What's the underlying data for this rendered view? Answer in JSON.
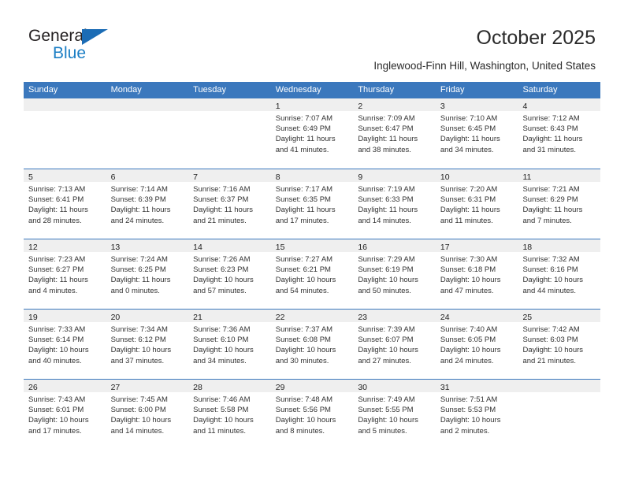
{
  "brand": {
    "name_top": "General",
    "name_bottom": "Blue"
  },
  "header": {
    "title": "October 2025",
    "subtitle": "Inglewood-Finn Hill, Washington, United States"
  },
  "colors": {
    "header_blue": "#3b78bd",
    "brand_blue": "#1b7ec4",
    "day_band_gray": "#efefef"
  },
  "weekdays": [
    "Sunday",
    "Monday",
    "Tuesday",
    "Wednesday",
    "Thursday",
    "Friday",
    "Saturday"
  ],
  "weeks": [
    [
      {
        "day": "",
        "empty": true
      },
      {
        "day": "",
        "empty": true
      },
      {
        "day": "",
        "empty": true
      },
      {
        "day": "1",
        "sunrise": "Sunrise: 7:07 AM",
        "sunset": "Sunset: 6:49 PM",
        "daylight1": "Daylight: 11 hours",
        "daylight2": "and 41 minutes."
      },
      {
        "day": "2",
        "sunrise": "Sunrise: 7:09 AM",
        "sunset": "Sunset: 6:47 PM",
        "daylight1": "Daylight: 11 hours",
        "daylight2": "and 38 minutes."
      },
      {
        "day": "3",
        "sunrise": "Sunrise: 7:10 AM",
        "sunset": "Sunset: 6:45 PM",
        "daylight1": "Daylight: 11 hours",
        "daylight2": "and 34 minutes."
      },
      {
        "day": "4",
        "sunrise": "Sunrise: 7:12 AM",
        "sunset": "Sunset: 6:43 PM",
        "daylight1": "Daylight: 11 hours",
        "daylight2": "and 31 minutes."
      }
    ],
    [
      {
        "day": "5",
        "sunrise": "Sunrise: 7:13 AM",
        "sunset": "Sunset: 6:41 PM",
        "daylight1": "Daylight: 11 hours",
        "daylight2": "and 28 minutes."
      },
      {
        "day": "6",
        "sunrise": "Sunrise: 7:14 AM",
        "sunset": "Sunset: 6:39 PM",
        "daylight1": "Daylight: 11 hours",
        "daylight2": "and 24 minutes."
      },
      {
        "day": "7",
        "sunrise": "Sunrise: 7:16 AM",
        "sunset": "Sunset: 6:37 PM",
        "daylight1": "Daylight: 11 hours",
        "daylight2": "and 21 minutes."
      },
      {
        "day": "8",
        "sunrise": "Sunrise: 7:17 AM",
        "sunset": "Sunset: 6:35 PM",
        "daylight1": "Daylight: 11 hours",
        "daylight2": "and 17 minutes."
      },
      {
        "day": "9",
        "sunrise": "Sunrise: 7:19 AM",
        "sunset": "Sunset: 6:33 PM",
        "daylight1": "Daylight: 11 hours",
        "daylight2": "and 14 minutes."
      },
      {
        "day": "10",
        "sunrise": "Sunrise: 7:20 AM",
        "sunset": "Sunset: 6:31 PM",
        "daylight1": "Daylight: 11 hours",
        "daylight2": "and 11 minutes."
      },
      {
        "day": "11",
        "sunrise": "Sunrise: 7:21 AM",
        "sunset": "Sunset: 6:29 PM",
        "daylight1": "Daylight: 11 hours",
        "daylight2": "and 7 minutes."
      }
    ],
    [
      {
        "day": "12",
        "sunrise": "Sunrise: 7:23 AM",
        "sunset": "Sunset: 6:27 PM",
        "daylight1": "Daylight: 11 hours",
        "daylight2": "and 4 minutes."
      },
      {
        "day": "13",
        "sunrise": "Sunrise: 7:24 AM",
        "sunset": "Sunset: 6:25 PM",
        "daylight1": "Daylight: 11 hours",
        "daylight2": "and 0 minutes."
      },
      {
        "day": "14",
        "sunrise": "Sunrise: 7:26 AM",
        "sunset": "Sunset: 6:23 PM",
        "daylight1": "Daylight: 10 hours",
        "daylight2": "and 57 minutes."
      },
      {
        "day": "15",
        "sunrise": "Sunrise: 7:27 AM",
        "sunset": "Sunset: 6:21 PM",
        "daylight1": "Daylight: 10 hours",
        "daylight2": "and 54 minutes."
      },
      {
        "day": "16",
        "sunrise": "Sunrise: 7:29 AM",
        "sunset": "Sunset: 6:19 PM",
        "daylight1": "Daylight: 10 hours",
        "daylight2": "and 50 minutes."
      },
      {
        "day": "17",
        "sunrise": "Sunrise: 7:30 AM",
        "sunset": "Sunset: 6:18 PM",
        "daylight1": "Daylight: 10 hours",
        "daylight2": "and 47 minutes."
      },
      {
        "day": "18",
        "sunrise": "Sunrise: 7:32 AM",
        "sunset": "Sunset: 6:16 PM",
        "daylight1": "Daylight: 10 hours",
        "daylight2": "and 44 minutes."
      }
    ],
    [
      {
        "day": "19",
        "sunrise": "Sunrise: 7:33 AM",
        "sunset": "Sunset: 6:14 PM",
        "daylight1": "Daylight: 10 hours",
        "daylight2": "and 40 minutes."
      },
      {
        "day": "20",
        "sunrise": "Sunrise: 7:34 AM",
        "sunset": "Sunset: 6:12 PM",
        "daylight1": "Daylight: 10 hours",
        "daylight2": "and 37 minutes."
      },
      {
        "day": "21",
        "sunrise": "Sunrise: 7:36 AM",
        "sunset": "Sunset: 6:10 PM",
        "daylight1": "Daylight: 10 hours",
        "daylight2": "and 34 minutes."
      },
      {
        "day": "22",
        "sunrise": "Sunrise: 7:37 AM",
        "sunset": "Sunset: 6:08 PM",
        "daylight1": "Daylight: 10 hours",
        "daylight2": "and 30 minutes."
      },
      {
        "day": "23",
        "sunrise": "Sunrise: 7:39 AM",
        "sunset": "Sunset: 6:07 PM",
        "daylight1": "Daylight: 10 hours",
        "daylight2": "and 27 minutes."
      },
      {
        "day": "24",
        "sunrise": "Sunrise: 7:40 AM",
        "sunset": "Sunset: 6:05 PM",
        "daylight1": "Daylight: 10 hours",
        "daylight2": "and 24 minutes."
      },
      {
        "day": "25",
        "sunrise": "Sunrise: 7:42 AM",
        "sunset": "Sunset: 6:03 PM",
        "daylight1": "Daylight: 10 hours",
        "daylight2": "and 21 minutes."
      }
    ],
    [
      {
        "day": "26",
        "sunrise": "Sunrise: 7:43 AM",
        "sunset": "Sunset: 6:01 PM",
        "daylight1": "Daylight: 10 hours",
        "daylight2": "and 17 minutes."
      },
      {
        "day": "27",
        "sunrise": "Sunrise: 7:45 AM",
        "sunset": "Sunset: 6:00 PM",
        "daylight1": "Daylight: 10 hours",
        "daylight2": "and 14 minutes."
      },
      {
        "day": "28",
        "sunrise": "Sunrise: 7:46 AM",
        "sunset": "Sunset: 5:58 PM",
        "daylight1": "Daylight: 10 hours",
        "daylight2": "and 11 minutes."
      },
      {
        "day": "29",
        "sunrise": "Sunrise: 7:48 AM",
        "sunset": "Sunset: 5:56 PM",
        "daylight1": "Daylight: 10 hours",
        "daylight2": "and 8 minutes."
      },
      {
        "day": "30",
        "sunrise": "Sunrise: 7:49 AM",
        "sunset": "Sunset: 5:55 PM",
        "daylight1": "Daylight: 10 hours",
        "daylight2": "and 5 minutes."
      },
      {
        "day": "31",
        "sunrise": "Sunrise: 7:51 AM",
        "sunset": "Sunset: 5:53 PM",
        "daylight1": "Daylight: 10 hours",
        "daylight2": "and 2 minutes."
      },
      {
        "day": "",
        "empty": true
      }
    ]
  ]
}
